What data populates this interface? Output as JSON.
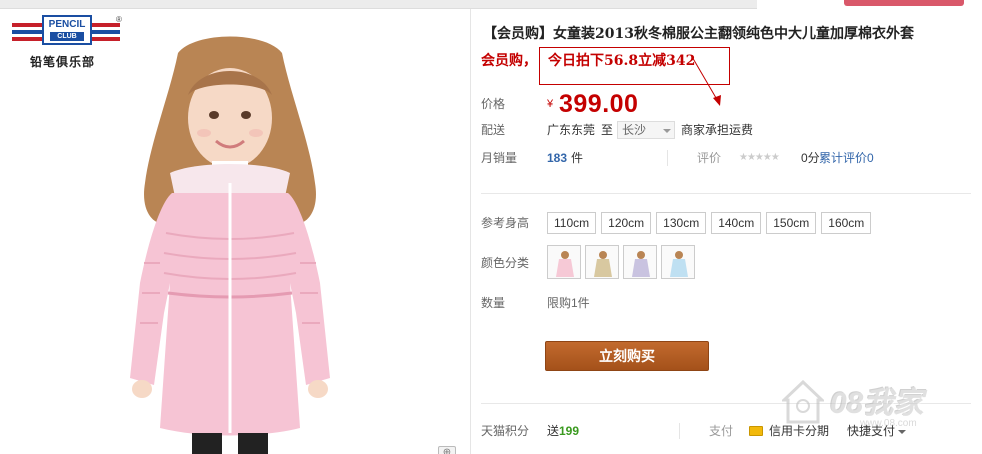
{
  "logo": {
    "brand_en": "PENCIL",
    "brand_en2": "CLUB",
    "reg_mark": "®",
    "brand_cn": "铅笔俱乐部"
  },
  "product": {
    "title": "【会员购】女童装2013秋冬棉服公主翻领纯色中大儿童加厚棉衣外套",
    "promo_prefix": "会员购，",
    "promo_boxed": "今日拍下56.8立减342"
  },
  "price": {
    "label": "价格",
    "currency": "¥",
    "value": "399.00"
  },
  "shipping": {
    "label": "配送",
    "from": "广东东莞",
    "to": "至",
    "destination": "长沙",
    "fee": "商家承担运费"
  },
  "sales": {
    "label": "月销量",
    "count": "183",
    "unit": "件",
    "reviews_label": "评价",
    "stars": "★★★★★",
    "score": "0分",
    "reviews_link": "累计评价0"
  },
  "sizes": {
    "label": "参考身高",
    "options": [
      "110cm",
      "120cm",
      "130cm",
      "140cm",
      "150cm",
      "160cm"
    ]
  },
  "colors": {
    "label": "颜色分类",
    "swatches": [
      {
        "name": "pink",
        "color": "#f6c9d6"
      },
      {
        "name": "khaki",
        "color": "#d8c8a0"
      },
      {
        "name": "lavender",
        "color": "#c9c3e0"
      },
      {
        "name": "sky",
        "color": "#bfe0f2"
      }
    ]
  },
  "quantity": {
    "label": "数量",
    "value": "限购1件"
  },
  "buy_button": "立刻购买",
  "points": {
    "label": "天猫积分",
    "prefix": "送",
    "value": "199",
    "pay_label": "支付",
    "credit_card": "信用卡分期",
    "quick_pay": "快捷支付"
  },
  "watermark": {
    "main": "08我家",
    "sub": "www.08.com"
  },
  "colors_theme": {
    "price_red": "#c40000",
    "buy_button": "#b35d23",
    "link_blue": "#3366aa",
    "points_green": "#3a9a1f"
  }
}
